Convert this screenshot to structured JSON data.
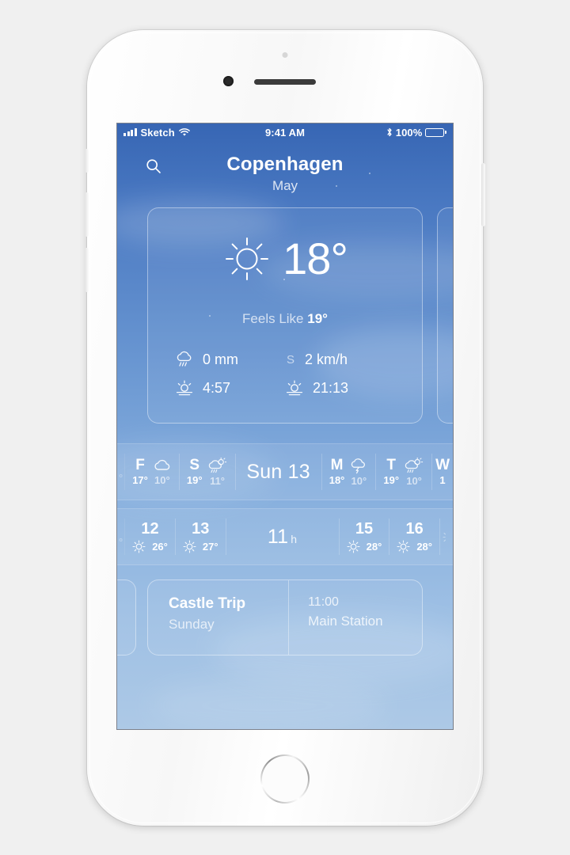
{
  "status_bar": {
    "carrier": "Sketch",
    "signal_icon": "signal-bars-icon",
    "wifi_icon": "wifi-icon",
    "time": "9:41 AM",
    "bluetooth_icon": "bluetooth-icon",
    "battery_percent": "100%",
    "battery_icon": "battery-full-icon"
  },
  "header": {
    "search_icon": "search-icon",
    "city": "Copenhagen",
    "month": "May"
  },
  "current": {
    "condition_icon": "sun-icon",
    "temperature": "18°",
    "feels_like_label": "Feels Like",
    "feels_like_value": "19°",
    "metrics": [
      {
        "icon": "rain-cloud-icon",
        "value": "0 mm"
      },
      {
        "icon": "wind-icon",
        "direction": "S",
        "value": "2 km/h"
      },
      {
        "icon": "sunrise-icon",
        "value": "4:57"
      },
      {
        "icon": "sunset-icon",
        "value": "21:13"
      }
    ]
  },
  "daily": {
    "selected_label": "Sun 13",
    "before": [
      {
        "letter": "F",
        "hi": "17°",
        "lo": "10°",
        "icon": "cloud-icon"
      },
      {
        "letter": "S",
        "hi": "19°",
        "lo": "11°",
        "icon": "sun-rain-icon"
      }
    ],
    "after": [
      {
        "letter": "M",
        "hi": "18°",
        "lo": "10°",
        "icon": "thunderstorm-icon"
      },
      {
        "letter": "T",
        "hi": "19°",
        "lo": "10°",
        "icon": "sun-rain-icon"
      },
      {
        "letter": "W",
        "hi": "1",
        "lo": "",
        "icon": ""
      }
    ]
  },
  "hourly": {
    "selected_value": "11",
    "selected_unit": "h",
    "before": [
      {
        "hour": "12",
        "temp": "26°",
        "icon": "sun-icon"
      },
      {
        "hour": "13",
        "temp": "27°",
        "icon": "sun-icon"
      }
    ],
    "after": [
      {
        "hour": "15",
        "temp": "28°",
        "icon": "sun-icon"
      },
      {
        "hour": "16",
        "temp": "28°",
        "icon": "sun-icon"
      }
    ]
  },
  "event": {
    "title": "Castle Trip",
    "day": "Sunday",
    "time": "11:00",
    "place": "Main Station"
  },
  "colors": {
    "sky_top": "#3766b4",
    "sky_bottom": "#adc9e6",
    "text_primary": "#ffffff",
    "frame": "#ffffff"
  }
}
